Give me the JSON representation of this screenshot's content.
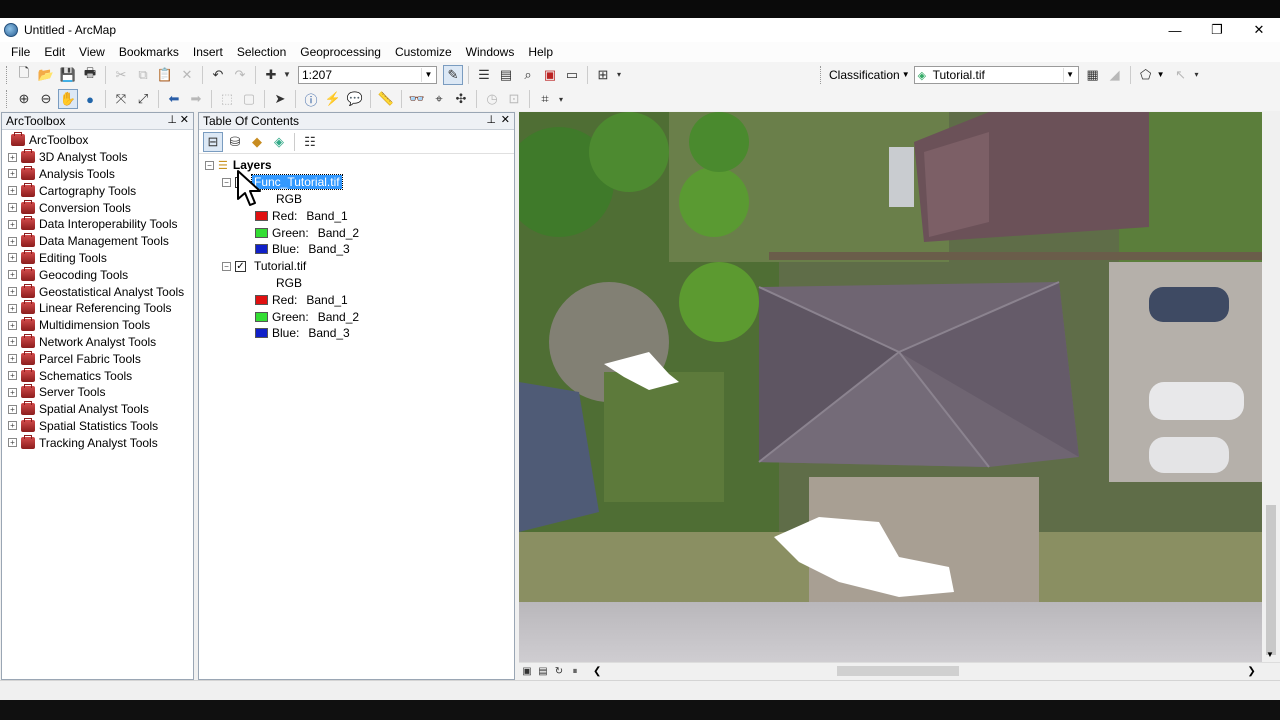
{
  "window": {
    "title": "Untitled - ArcMap",
    "minimize": "—",
    "restore": "❐",
    "close": "✕"
  },
  "menu": [
    "File",
    "Edit",
    "View",
    "Bookmarks",
    "Insert",
    "Selection",
    "Geoprocessing",
    "Customize",
    "Windows",
    "Help"
  ],
  "toolbar": {
    "scale_value": "1:207",
    "classification_label": "Classification",
    "classification_layer": "Tutorial.tif"
  },
  "arctoolbox": {
    "title": "ArcToolbox",
    "root": "ArcToolbox",
    "items": [
      "3D Analyst Tools",
      "Analysis Tools",
      "Cartography Tools",
      "Conversion Tools",
      "Data Interoperability Tools",
      "Data Management Tools",
      "Editing Tools",
      "Geocoding Tools",
      "Geostatistical Analyst Tools",
      "Linear Referencing Tools",
      "Multidimension Tools",
      "Network Analyst Tools",
      "Parcel Fabric Tools",
      "Schematics Tools",
      "Server Tools",
      "Spatial Analyst Tools",
      "Spatial Statistics Tools",
      "Tracking Analyst Tools"
    ]
  },
  "toc": {
    "title": "Table Of Contents",
    "group": "Layers",
    "layers": [
      {
        "name": "Func_Tutorial.tif",
        "selected": true,
        "checked": true,
        "renderer": "RGB",
        "bands": [
          {
            "channel": "Red:",
            "band": "Band_1",
            "color": "#e01010"
          },
          {
            "channel": "Green:",
            "band": "Band_2",
            "color": "#33dd33"
          },
          {
            "channel": "Blue:",
            "band": "Band_3",
            "color": "#1020c8"
          }
        ]
      },
      {
        "name": "Tutorial.tif",
        "selected": false,
        "checked": true,
        "renderer": "RGB",
        "bands": [
          {
            "channel": "Red:",
            "band": "Band_1",
            "color": "#e01010"
          },
          {
            "channel": "Green:",
            "band": "Band_2",
            "color": "#33dd33"
          },
          {
            "channel": "Blue:",
            "band": "Band_3",
            "color": "#1020c8"
          }
        ]
      }
    ]
  },
  "colors": {
    "selection": "#3399ff",
    "panel_border": "#9aa6b4"
  }
}
